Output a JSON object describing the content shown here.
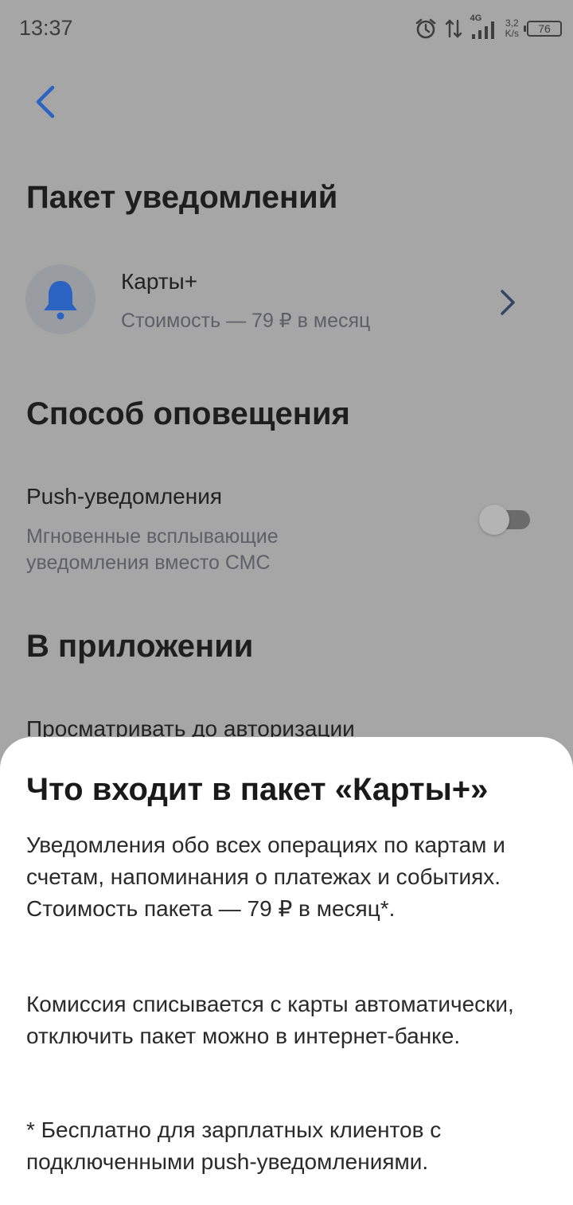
{
  "status_bar": {
    "time": "13:37",
    "network_type": "4G",
    "speed_value": "3,2",
    "speed_unit": "K/s",
    "battery": "76"
  },
  "header": {
    "back_icon": "chevron-left-icon"
  },
  "package_section": {
    "title": "Пакет уведомлений",
    "item": {
      "icon": "bell-icon",
      "name": "Карты+",
      "price": "Стоимость — 79 ₽ в месяц"
    }
  },
  "notify_section": {
    "title": "Способ оповещения",
    "push": {
      "label": "Push-уведомления",
      "description": "Мгновенные всплывающие уведомления вместо СМС",
      "enabled": false
    }
  },
  "app_section": {
    "title": "В приложении",
    "item_label": "Просматривать до авторизации"
  },
  "sheet": {
    "title": "Что входит в пакет «Карты+»",
    "paragraph1": "Уведомления обо всех операциях по картам и счетам, напоминания о платежах и событиях. Стоимость пакета — 79 ₽ в месяц*.",
    "paragraph2": "Комиссия списывается с карты автоматически, отключить пакет можно в интернет-банке.",
    "footnote": "* Бесплатно для зарплатных клиентов с подключенными push-уведомлениями."
  },
  "colors": {
    "accent": "#2b63c3",
    "overlay_bg": "#a6a6a6",
    "sheet_bg": "#ffffff"
  }
}
